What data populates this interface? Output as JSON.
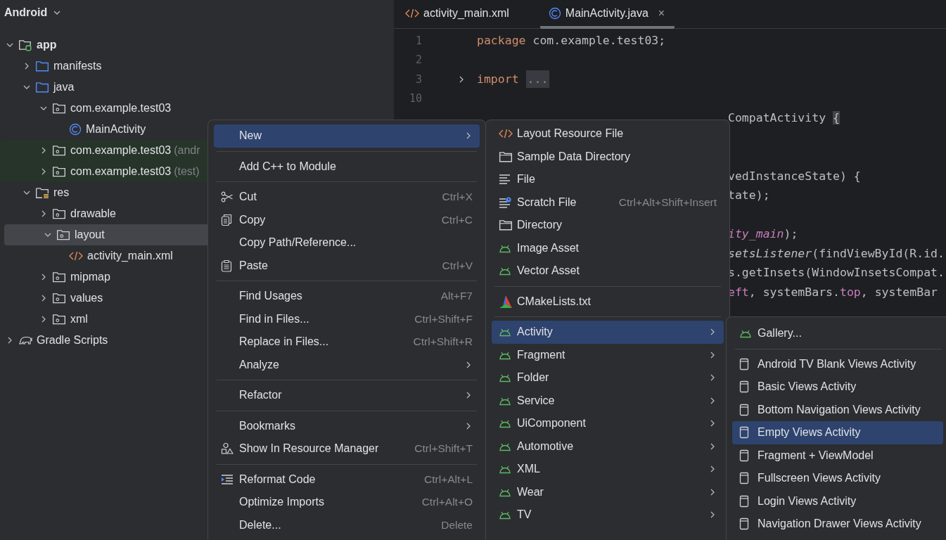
{
  "project": {
    "title": "Android",
    "tree": [
      {
        "label": "app",
        "kind": "module",
        "expanded": true,
        "selected": false,
        "children": [
          {
            "label": "manifests",
            "kind": "source-folder",
            "expanded": false,
            "selected": false
          },
          {
            "label": "java",
            "kind": "source-folder",
            "expanded": true,
            "selected": false,
            "children": [
              {
                "label": "com.example.test03",
                "kind": "package",
                "expanded": true,
                "selected": false,
                "children": [
                  {
                    "label": "MainActivity",
                    "kind": "class",
                    "selected": false
                  }
                ]
              },
              {
                "label": "com.example.test03",
                "qualifier": "(andr",
                "kind": "package",
                "expanded": false,
                "selected": false,
                "highlighted": true
              },
              {
                "label": "com.example.test03",
                "qualifier": "(test)",
                "kind": "package",
                "expanded": false,
                "selected": false,
                "highlighted": true
              }
            ]
          },
          {
            "label": "res",
            "kind": "res-folder",
            "expanded": true,
            "selected": false,
            "children": [
              {
                "label": "drawable",
                "kind": "package",
                "expanded": false,
                "selected": false
              },
              {
                "label": "layout",
                "kind": "package",
                "expanded": true,
                "selected": true,
                "children": [
                  {
                    "label": "activity_main.xml",
                    "kind": "xml",
                    "selected": false
                  }
                ]
              },
              {
                "label": "mipmap",
                "kind": "package",
                "expanded": false,
                "selected": false
              },
              {
                "label": "values",
                "kind": "package",
                "expanded": false,
                "selected": false
              },
              {
                "label": "xml",
                "kind": "package",
                "expanded": false,
                "selected": false
              }
            ]
          }
        ]
      },
      {
        "label": "Gradle Scripts",
        "kind": "gradle",
        "expanded": false,
        "selected": false
      }
    ]
  },
  "editor": {
    "tabs": [
      {
        "label": "activity_main.xml",
        "kind": "xml",
        "selected": false
      },
      {
        "label": "MainActivity.java",
        "kind": "class",
        "selected": true,
        "close": "×"
      }
    ],
    "lines": [
      {
        "kind": "numbered",
        "number": "1",
        "tokens": [
          {
            "kind": "keyword",
            "text": "package"
          },
          {
            "kind": "plain",
            "text": " com.example.test03;"
          }
        ]
      },
      {
        "kind": "numbered",
        "number": "2"
      },
      {
        "kind": "numbered",
        "number": "3",
        "folded": true,
        "tokens": [
          {
            "kind": "keyword",
            "text": "import"
          },
          {
            "kind": "fold",
            "text": "..."
          }
        ]
      },
      {
        "kind": "numbered",
        "number": "10"
      },
      {
        "kind": "fragment",
        "tokens": [
          {
            "kind": "plain",
            "text": "CompatActivity "
          },
          {
            "kind": "brace",
            "text": "{"
          }
        ]
      },
      {
        "kind": "hidden"
      },
      {
        "kind": "hidden"
      },
      {
        "kind": "fragment",
        "tokens": [
          {
            "kind": "plain",
            "text": "vedInstanceState) {"
          }
        ]
      },
      {
        "kind": "fragment",
        "tokens": [
          {
            "kind": "plain",
            "text": "tate);"
          }
        ]
      },
      {
        "kind": "hidden"
      },
      {
        "kind": "fragment",
        "tokens": [
          {
            "kind": "static-field",
            "text": "ity_main"
          },
          {
            "kind": "plain",
            "text": ");"
          }
        ]
      },
      {
        "kind": "fragment",
        "tokens": [
          {
            "kind": "static-method",
            "text": "setsListener"
          },
          {
            "kind": "plain",
            "text": "(findViewById(R.id."
          }
        ]
      },
      {
        "kind": "fragment",
        "tokens": [
          {
            "kind": "plain",
            "text": "s.getInsets(WindowInsetsCompat."
          }
        ]
      },
      {
        "kind": "fragment",
        "tokens": [
          {
            "kind": "field",
            "text": "eft"
          },
          {
            "kind": "plain",
            "text": ", systemBars."
          },
          {
            "kind": "field",
            "text": "top"
          },
          {
            "kind": "plain",
            "text": ", systemBar"
          }
        ]
      }
    ]
  },
  "menus": [
    {
      "kind": "context",
      "items": [
        {
          "kind": "plain",
          "label": "New",
          "submenu": true,
          "selected": true
        },
        {
          "kind": "separator"
        },
        {
          "kind": "plain",
          "label": "Add C++ to Module",
          "selected": false
        },
        {
          "kind": "separator"
        },
        {
          "kind": "scissors",
          "label": "Cut",
          "shortcut": "Ctrl+X",
          "selected": false
        },
        {
          "kind": "copy",
          "label": "Copy",
          "shortcut": "Ctrl+C",
          "selected": false
        },
        {
          "kind": "plain",
          "label": "Copy Path/Reference...",
          "selected": false
        },
        {
          "kind": "paste",
          "label": "Paste",
          "shortcut": "Ctrl+V",
          "selected": false
        },
        {
          "kind": "separator"
        },
        {
          "kind": "plain",
          "label": "Find Usages",
          "shortcut": "Alt+F7",
          "selected": false
        },
        {
          "kind": "plain",
          "label": "Find in Files...",
          "shortcut": "Ctrl+Shift+F",
          "selected": false
        },
        {
          "kind": "plain",
          "label": "Replace in Files...",
          "shortcut": "Ctrl+Shift+R",
          "selected": false
        },
        {
          "kind": "plain",
          "label": "Analyze",
          "submenu": true,
          "selected": false
        },
        {
          "kind": "separator"
        },
        {
          "kind": "plain",
          "label": "Refactor",
          "submenu": true,
          "selected": false
        },
        {
          "kind": "separator"
        },
        {
          "kind": "plain",
          "label": "Bookmarks",
          "submenu": true,
          "selected": false
        },
        {
          "kind": "shapes",
          "label": "Show In Resource Manager",
          "shortcut": "Ctrl+Shift+T",
          "selected": false
        },
        {
          "kind": "separator"
        },
        {
          "kind": "indent",
          "label": "Reformat Code",
          "shortcut": "Ctrl+Alt+L",
          "selected": false
        },
        {
          "kind": "plain",
          "label": "Optimize Imports",
          "shortcut": "Ctrl+Alt+O",
          "selected": false
        },
        {
          "kind": "plain",
          "label": "Delete...",
          "shortcut": "Delete",
          "selected": false
        }
      ]
    },
    {
      "kind": "new",
      "items": [
        {
          "kind": "xml",
          "label": "Layout Resource File",
          "selected": false
        },
        {
          "kind": "folder",
          "label": "Sample Data Directory",
          "selected": false
        },
        {
          "kind": "lines",
          "label": "File",
          "selected": false
        },
        {
          "kind": "scratch",
          "label": "Scratch File",
          "shortcut": "Ctrl+Alt+Shift+Insert",
          "selected": false
        },
        {
          "kind": "folder",
          "label": "Directory",
          "selected": false
        },
        {
          "kind": "android",
          "label": "Image Asset",
          "selected": false
        },
        {
          "kind": "android",
          "label": "Vector Asset",
          "selected": false
        },
        {
          "kind": "separator"
        },
        {
          "kind": "cmake",
          "label": "CMakeLists.txt",
          "selected": false
        },
        {
          "kind": "separator"
        },
        {
          "kind": "android",
          "label": "Activity",
          "submenu": true,
          "selected": true
        },
        {
          "kind": "android",
          "label": "Fragment",
          "submenu": true,
          "selected": false
        },
        {
          "kind": "android",
          "label": "Folder",
          "submenu": true,
          "selected": false
        },
        {
          "kind": "android",
          "label": "Service",
          "submenu": true,
          "selected": false
        },
        {
          "kind": "android",
          "label": "UiComponent",
          "submenu": true,
          "selected": false
        },
        {
          "kind": "android",
          "label": "Automotive",
          "submenu": true,
          "selected": false
        },
        {
          "kind": "android",
          "label": "XML",
          "submenu": true,
          "selected": false
        },
        {
          "kind": "android",
          "label": "Wear",
          "submenu": true,
          "selected": false
        },
        {
          "kind": "android",
          "label": "TV",
          "submenu": true,
          "selected": false
        }
      ]
    },
    {
      "kind": "activity",
      "items": [
        {
          "kind": "android",
          "label": "Gallery...",
          "selected": false
        },
        {
          "kind": "separator"
        },
        {
          "kind": "device",
          "label": "Android TV Blank Views Activity",
          "selected": false
        },
        {
          "kind": "device",
          "label": "Basic Views Activity",
          "selected": false
        },
        {
          "kind": "device",
          "label": "Bottom Navigation Views Activity",
          "selected": false
        },
        {
          "kind": "device",
          "label": "Empty Views Activity",
          "selected": true
        },
        {
          "kind": "device",
          "label": "Fragment + ViewModel",
          "selected": false
        },
        {
          "kind": "device",
          "label": "Fullscreen Views Activity",
          "selected": false
        },
        {
          "kind": "device",
          "label": "Login Views Activity",
          "selected": false
        },
        {
          "kind": "device",
          "label": "Navigation Drawer Views Activity",
          "selected": false
        }
      ]
    }
  ]
}
